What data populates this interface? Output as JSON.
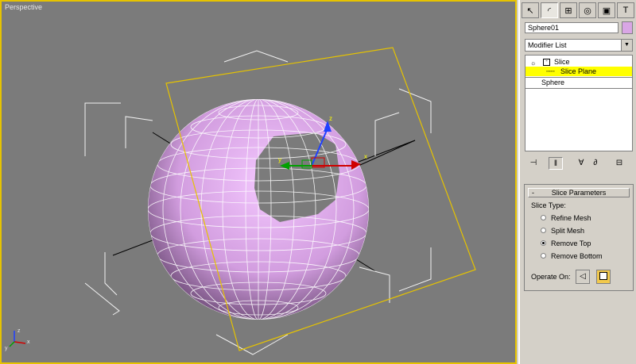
{
  "viewport": {
    "label": "Perspective"
  },
  "gizmo": {
    "x": "x",
    "y": "y",
    "z": "z"
  },
  "panel": {
    "tabs": [
      {
        "name": "create",
        "icon": "cursor-icon",
        "glyph": "↖"
      },
      {
        "name": "modify",
        "icon": "curve-icon",
        "glyph": "◜"
      },
      {
        "name": "hierarchy",
        "icon": "hierarchy-icon",
        "glyph": "⊞"
      },
      {
        "name": "motion",
        "icon": "motion-icon",
        "glyph": "◎"
      },
      {
        "name": "display",
        "icon": "display-icon",
        "glyph": "▣"
      },
      {
        "name": "utilities",
        "icon": "hammer-icon",
        "glyph": "T"
      }
    ],
    "object_name": "Sphere01",
    "object_color": "#d9a6e5",
    "modifier_list": "Modifier List",
    "stack": [
      {
        "label": "Slice",
        "selected": false
      },
      {
        "label": "Slice Plane",
        "selected": true
      },
      {
        "label": "Sphere",
        "selected": false
      }
    ],
    "rollout": {
      "title": "Slice Parameters",
      "toggle": "-",
      "slice_type_label": "Slice Type:",
      "options": [
        {
          "label": "Refine Mesh",
          "checked": false
        },
        {
          "label": "Split Mesh",
          "checked": false
        },
        {
          "label": "Remove Top",
          "checked": true
        },
        {
          "label": "Remove Bottom",
          "checked": false
        }
      ],
      "operate_on_label": "Operate On:"
    }
  },
  "colors": {
    "viewport_bg": "#7b7b7b",
    "selection_yellow": "#ffff00",
    "sphere": "#d9a6e5",
    "slice_plane": "#e6c300"
  }
}
